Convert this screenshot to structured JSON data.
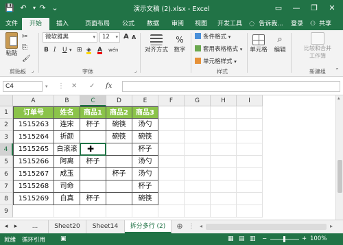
{
  "titlebar": {
    "title": "演示文稿 (2).xlsx - Excel",
    "save_glyph": "💾",
    "undo_glyph": "↶",
    "redo_glyph": "↷",
    "customize_glyph": "⌄",
    "ribbon_options_glyph": "▭",
    "minimize_glyph": "—",
    "restore_glyph": "❐",
    "close_glyph": "✕"
  },
  "tabs": [
    "文件",
    "开始",
    "插入",
    "页面布局",
    "公式",
    "数据",
    "审阅",
    "视图",
    "开发工具"
  ],
  "active_tab": "开始",
  "tellme": "告诉我...",
  "signin": "登录",
  "share": "共享",
  "ribbon": {
    "paste": "粘贴",
    "clipboard": "剪贴板",
    "font_name": "微软雅黑",
    "font_size": "12",
    "font_group": "字体",
    "bold": "B",
    "italic": "I",
    "underline": "U",
    "grow_font": "A",
    "shrink_font": "A",
    "font_color": "A",
    "phonetic": "wén",
    "align": "对齐方式",
    "number": "数字",
    "cond_format": "条件格式",
    "table_format": "套用表格格式",
    "cell_style": "单元格样式",
    "styles_group": "样式",
    "cells": "单元格",
    "editing": "编辑",
    "merge_line1": "比较和合并",
    "merge_line2": "工作簿",
    "new_group": "新建组",
    "accent": "#217346"
  },
  "formula_bar": {
    "name_box": "C4",
    "cancel": "✕",
    "confirm": "✓",
    "fx": "fx",
    "value": ""
  },
  "columns": [
    "A",
    "B",
    "C",
    "D",
    "E",
    "F",
    "G",
    "H",
    "I"
  ],
  "rows": [
    "1",
    "2",
    "3",
    "4",
    "5",
    "6",
    "7",
    "8",
    "9"
  ],
  "table": {
    "header": [
      "订单号",
      "姓名",
      "商品1",
      "商品2",
      "商品3"
    ],
    "rows": [
      [
        "1515263",
        "连宋",
        "杯子",
        "碗筷",
        "汤勺"
      ],
      [
        "1515264",
        "折颜",
        "",
        "碗筷",
        "碗筷"
      ],
      [
        "1515265",
        "白滚滚",
        "",
        "",
        "杯子"
      ],
      [
        "1515266",
        "阿离",
        "杯子",
        "",
        "汤勺"
      ],
      [
        "1515267",
        "成玉",
        "",
        "杯子",
        "汤勺"
      ],
      [
        "1515268",
        "司命",
        "",
        "",
        "杯子"
      ],
      [
        "1515269",
        "白真",
        "杯子",
        "",
        "碗筷"
      ]
    ],
    "header_color": "#8bc34a"
  },
  "selected_cell": "C4",
  "sheets": [
    "Sheet20",
    "Sheet14",
    "拆分多行 (2)"
  ],
  "active_sheet": "拆分多行 (2)",
  "sheet_more": "...",
  "add_sheet": "⊕",
  "status": {
    "ready": "就绪",
    "circular": "循环引用",
    "zoom": "100%"
  }
}
